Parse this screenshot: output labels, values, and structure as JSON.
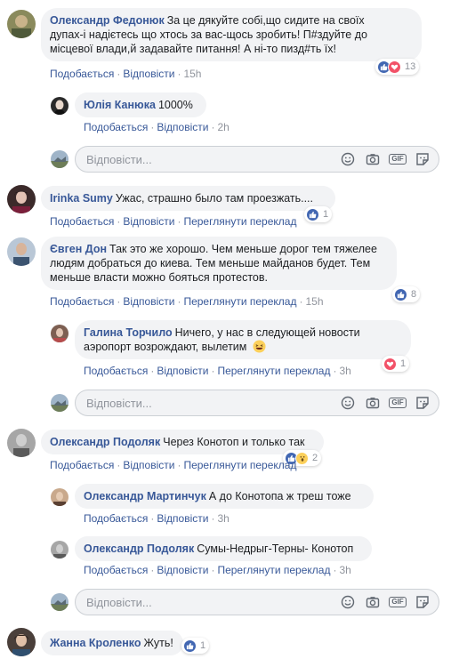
{
  "colors": {
    "link": "#385898",
    "muted": "#90949c",
    "bubble": "#f2f3f5",
    "like": "#4267b2",
    "love": "#f25268"
  },
  "comments": [
    {
      "name": "Олександр Федонюк",
      "line1": "За це дякуйте собі,що сидите на своїх",
      "line2": "дупах-і надієтесь що хтось за вас-щось зробить! П#здуйте до",
      "line3": "місцевої влади,й задавайте питання! А ні-то пизд#ть їх!",
      "like": "Подобається",
      "reply": "Відповісти",
      "time": "15h",
      "reactions": {
        "icons": [
          "like-icon",
          "love-icon"
        ],
        "count": "13"
      }
    },
    {
      "name": "Юлія Канюка",
      "text": "1000%",
      "like": "Подобається",
      "reply": "Відповісти",
      "time": "2h"
    },
    {
      "name": "Irinka Sumy",
      "text": "Ужас, страшно было там проезжать....",
      "like": "Подобається",
      "reply": "Відповісти",
      "translate": "Переглянути переклад",
      "time": "15h",
      "reactions": {
        "icons": [
          "like-icon"
        ],
        "count": "1"
      }
    },
    {
      "name": "Євген Дон",
      "line1": "Так это же хорошо. Чем меньше дорог тем тяжелее",
      "line2": "людям добраться до киева. Тем меньше майданов будет. Тем",
      "line3": "меньше власти можно бояться протестов.",
      "like": "Подобається",
      "reply": "Відповісти",
      "translate": "Переглянути переклад",
      "time": "15h",
      "reactions": {
        "icons": [
          "like-icon"
        ],
        "count": "8"
      }
    },
    {
      "name": "Галина Торчило",
      "line1": "Ничего, у нас в следующей новости",
      "line2": "аэропорт возрождают, вылетим",
      "like": "Подобається",
      "reply": "Відповісти",
      "translate": "Переглянути переклад",
      "time": "3h",
      "reactions": {
        "icons": [
          "love-icon"
        ],
        "count": "1"
      }
    },
    {
      "name": "Олександр Подоляк",
      "text": "Через Конотоп и только так",
      "like": "Подобається",
      "reply": "Відповісти",
      "translate": "Переглянути переклад",
      "time": "15h",
      "reactions": {
        "icons": [
          "like-icon",
          "wow-icon"
        ],
        "count": "2"
      }
    },
    {
      "name": "Олександр Мартинчук",
      "text": "А до Конотопа ж треш тоже",
      "like": "Подобається",
      "reply": "Відповісти",
      "time": "3h"
    },
    {
      "name": "Олександр Подоляк",
      "text": "Сумы-Недрыг-Терны- Конотоп",
      "like": "Подобається",
      "reply": "Відповісти",
      "translate": "Переглянути переклад",
      "time": "3h"
    },
    {
      "name": "Жанна Кроленко",
      "text": "Жуть!",
      "reactions": {
        "icons": [
          "like-icon"
        ],
        "count": "1"
      }
    }
  ],
  "reply_box": {
    "placeholder": "Відповісти..."
  },
  "reply_tools": [
    "smiley-icon",
    "camera-icon",
    "gif-icon",
    "sticker-icon"
  ]
}
